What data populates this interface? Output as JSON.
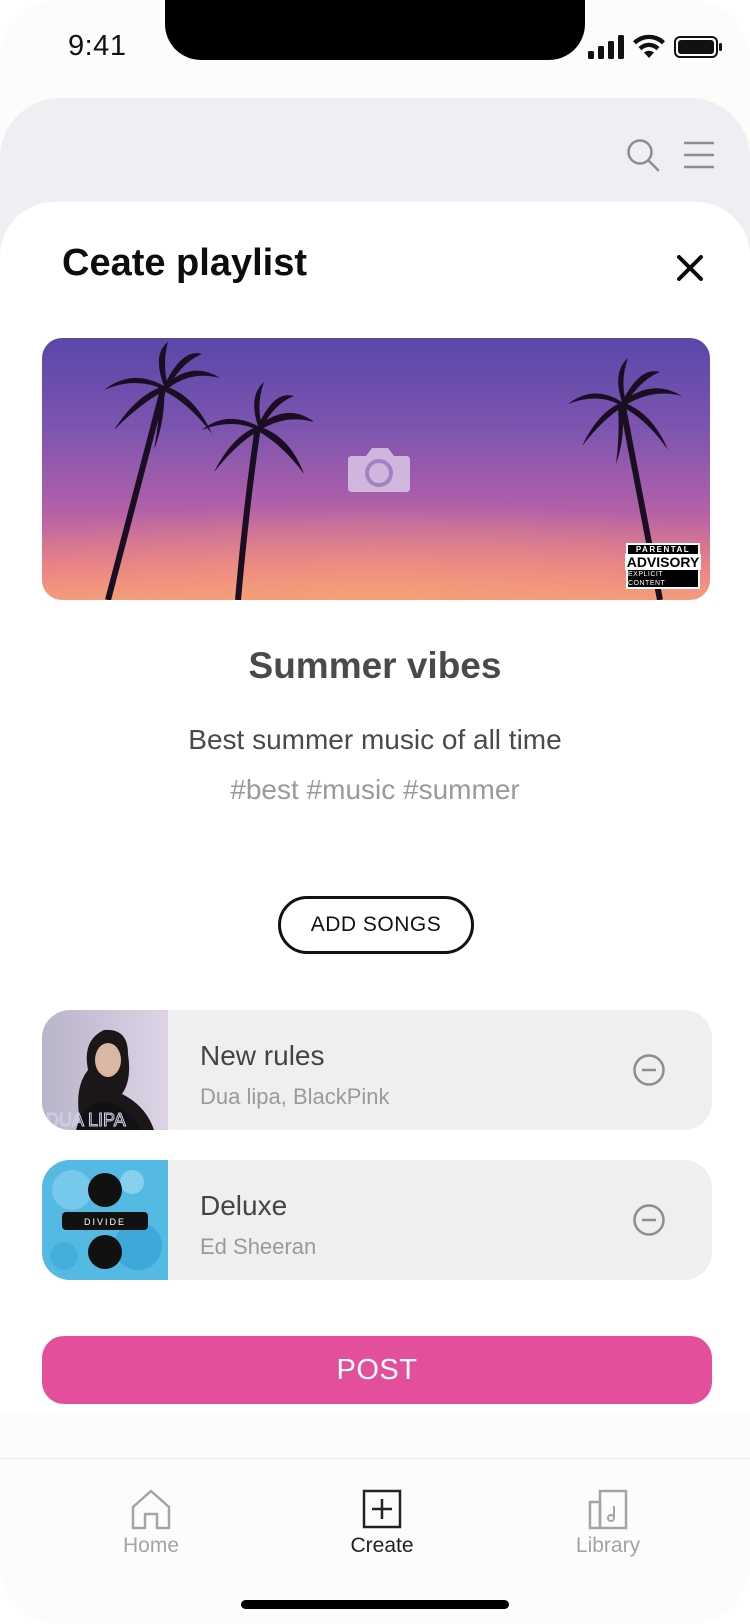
{
  "status_bar": {
    "time": "9:41"
  },
  "header": {
    "search_icon": "search-icon",
    "menu_icon": "menu-icon"
  },
  "sheet": {
    "title": "Ceate playlist",
    "close_icon": "close-icon",
    "cover": {
      "camera_icon": "camera-icon",
      "advisory": {
        "line1": "PARENTAL",
        "line2": "ADVISORY",
        "line3": "EXPLICIT CONTENT"
      }
    },
    "playlist_name": "Summer vibes",
    "description": "Best summer music of all time",
    "tags": "#best #music #summer",
    "add_songs_label": "ADD SONGS",
    "songs": [
      {
        "title": "New rules",
        "artist": "Dua lipa, BlackPink",
        "art_text": "DUA LIPA"
      },
      {
        "title": "Deluxe",
        "artist": "Ed Sheeran",
        "art_text": "DIVIDE"
      }
    ],
    "post_label": "POST"
  },
  "tabbar": {
    "items": [
      {
        "label": "Home",
        "icon": "home-icon",
        "active": false
      },
      {
        "label": "Create",
        "icon": "plus-square-icon",
        "active": true
      },
      {
        "label": "Library",
        "icon": "library-icon",
        "active": false
      }
    ]
  },
  "colors": {
    "accent": "#e34f9a",
    "sheet_bg": "#ffffff",
    "card_bg": "#efeff2",
    "text_dark": "#4a4a4a",
    "text_muted": "#9a9a9a"
  }
}
